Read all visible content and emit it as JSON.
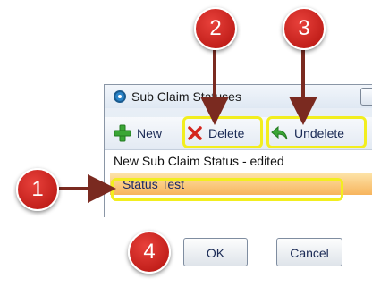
{
  "window": {
    "title": "Sub Claim Statuses"
  },
  "toolbar": {
    "new_label": "New",
    "delete_label": "Delete",
    "undelete_label": "Undelete"
  },
  "list": {
    "items": [
      "New Sub Claim Status - edited",
      "Status Test"
    ],
    "selected_index": 1
  },
  "dialog": {
    "ok_label": "OK",
    "cancel_label": "Cancel"
  },
  "callouts": [
    "1",
    "2",
    "3",
    "4"
  ],
  "colors": {
    "highlight": "#f2ee1f",
    "marker": "#d32a24",
    "arrow": "#7a2a20",
    "selection": "#f7b45c"
  },
  "icons": {
    "app": "app-circle-icon",
    "new": "green-plus-icon",
    "delete": "red-x-icon",
    "undelete": "green-undo-arrow-icon"
  }
}
